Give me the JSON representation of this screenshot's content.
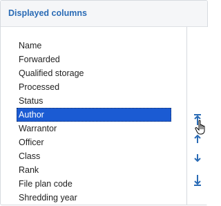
{
  "panel": {
    "title": "Displayed columns"
  },
  "columns": [
    {
      "label": "Name",
      "selected": false
    },
    {
      "label": "Forwarded",
      "selected": false
    },
    {
      "label": "Qualified storage",
      "selected": false
    },
    {
      "label": "Processed",
      "selected": false
    },
    {
      "label": "Status",
      "selected": false
    },
    {
      "label": "Author",
      "selected": true
    },
    {
      "label": "Warrantor",
      "selected": false
    },
    {
      "label": "Officer",
      "selected": false
    },
    {
      "label": "Class",
      "selected": false
    },
    {
      "label": "Rank",
      "selected": false
    },
    {
      "label": "File plan code",
      "selected": false
    },
    {
      "label": "Shredding year",
      "selected": false
    }
  ],
  "buttons": {
    "move_top_icon": "move-to-top-icon",
    "move_up_down_icon": "move-up-down-icon",
    "move_bottom_icon": "move-to-bottom-icon"
  },
  "colors": {
    "accent": "#2a6bb5",
    "selection": "#1b5bd3",
    "icon": "#2a6bb5"
  }
}
